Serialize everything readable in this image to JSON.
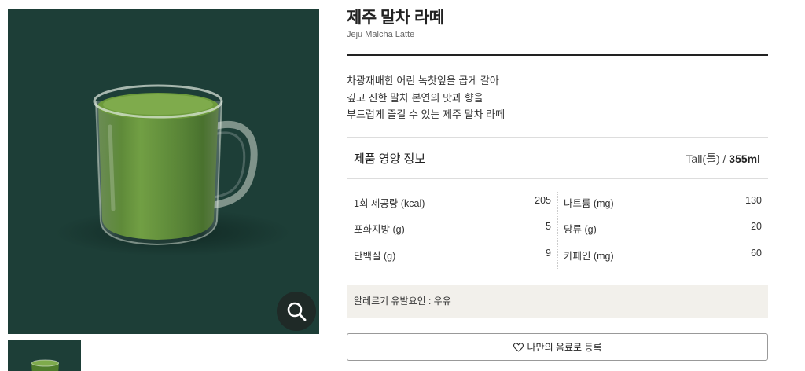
{
  "product": {
    "name_ko": "제주 말차 라떼",
    "name_en": "Jeju Malcha Latte",
    "description": [
      "차광재배한 어린 녹찻잎을 곱게 갈아",
      "깊고 진한 말차 본연의 맛과 향을",
      "부드럽게 즐길 수 있는 제주 말차 라떼"
    ]
  },
  "nutrition": {
    "title": "제품 영양 정보",
    "size_label": "Tall(톨) / ",
    "size_volume": "355ml",
    "rows": [
      {
        "left_label": "1회 제공량 (kcal)",
        "left_value": "205",
        "right_label": "나트륨 (mg)",
        "right_value": "130"
      },
      {
        "left_label": "포화지방 (g)",
        "left_value": "5",
        "right_label": "당류 (g)",
        "right_value": "20"
      },
      {
        "left_label": "단백질 (g)",
        "left_value": "9",
        "right_label": "카페인 (mg)",
        "right_value": "60"
      }
    ]
  },
  "allergy": "알레르기 유발요인 : 우유",
  "favorite_button": "나만의 음료로 등록",
  "icons": {
    "zoom": "magnifier-icon",
    "favorite": "heart-outline-icon"
  },
  "colors": {
    "image_bg": "#1d3e37",
    "latte_green": "#4f7d2c",
    "allergy_bg": "#f2f0eb"
  }
}
